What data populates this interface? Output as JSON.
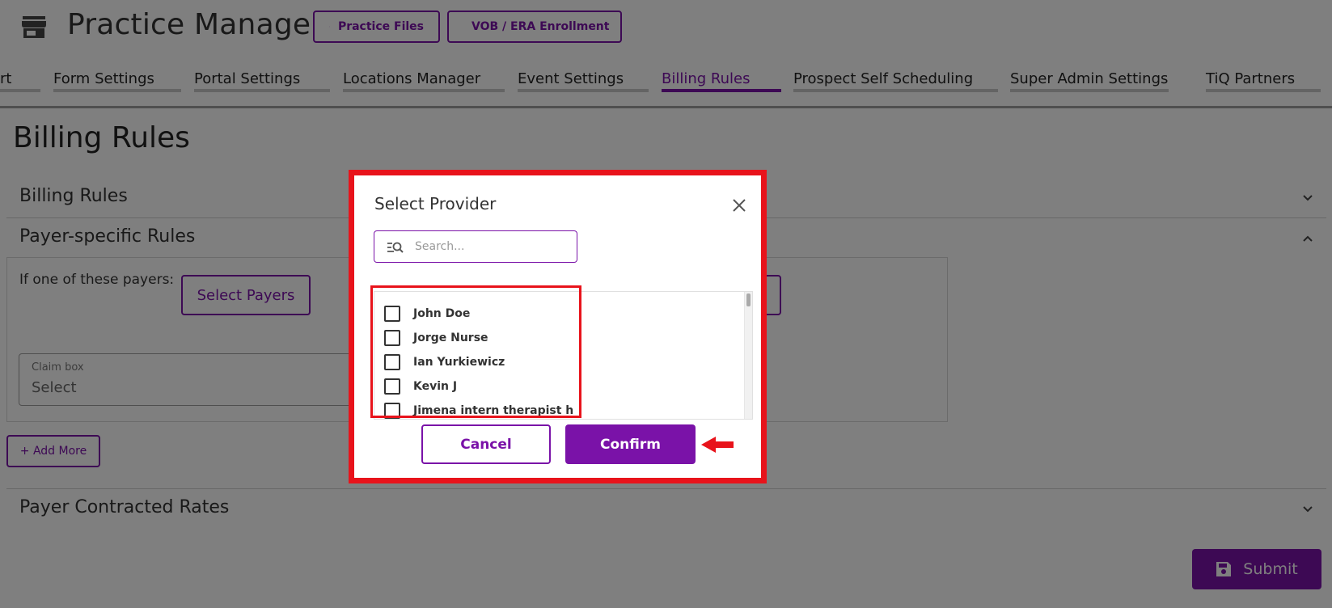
{
  "header": {
    "app_title": "Practice Manager",
    "practice_files_label": "Practice Files",
    "vob_label": "VOB / ERA Enrollment"
  },
  "tabs": [
    {
      "label": "rt",
      "active": false
    },
    {
      "label": "Form Settings",
      "active": false
    },
    {
      "label": "Portal Settings",
      "active": false
    },
    {
      "label": "Locations Manager",
      "active": false
    },
    {
      "label": "Event Settings",
      "active": false
    },
    {
      "label": "Billing Rules",
      "active": true
    },
    {
      "label": "Prospect Self Scheduling",
      "active": false
    },
    {
      "label": "Super Admin Settings",
      "active": false
    },
    {
      "label": "TiQ Partners",
      "active": false
    }
  ],
  "page": {
    "title": "Billing Rules",
    "sections": {
      "billing_rules": "Billing Rules",
      "payer_specific": "Payer-specific Rules",
      "payer_contracted": "Payer Contracted Rates"
    },
    "if_label": "If one of these payers:",
    "select_payers_label": "Select Payers",
    "claim_box": {
      "label": "Claim box",
      "value": "Select"
    },
    "add_more_label": "+ Add More",
    "submit_label": "Submit"
  },
  "modal": {
    "title": "Select Provider",
    "search_placeholder": "Search...",
    "providers": [
      {
        "name": "John Doe",
        "checked": false
      },
      {
        "name": "Jorge Nurse",
        "checked": false
      },
      {
        "name": "Ian Yurkiewicz",
        "checked": false
      },
      {
        "name": "Kevin J",
        "checked": false
      },
      {
        "name": "Jimena intern therapist h",
        "checked": false
      }
    ],
    "cancel_label": "Cancel",
    "confirm_label": "Confirm"
  },
  "colors": {
    "brand": "#7a12a8",
    "annotation": "#e8131b"
  }
}
